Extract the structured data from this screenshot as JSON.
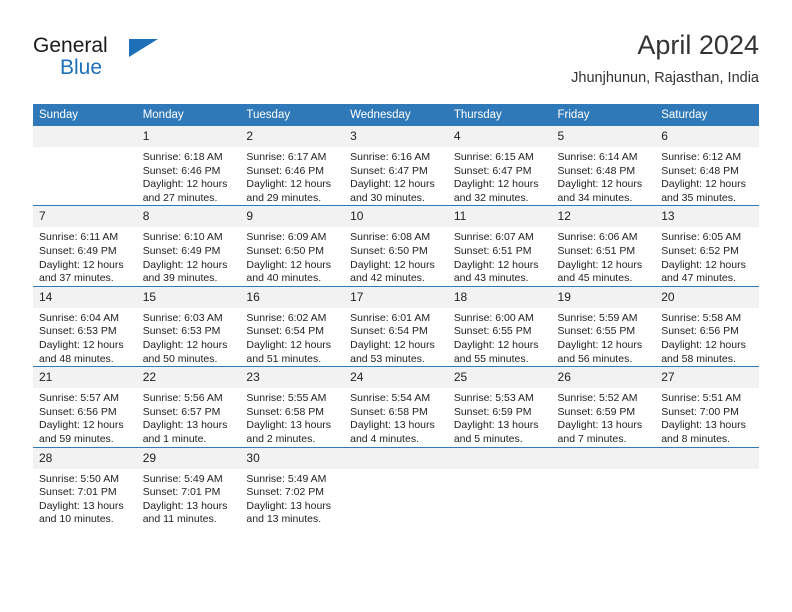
{
  "brand": {
    "name_part1": "General",
    "name_part2": "Blue"
  },
  "header": {
    "title": "April 2024",
    "subtitle": "Jhunjhunun, Rajasthan, India"
  },
  "weekday_headers": [
    "Sunday",
    "Monday",
    "Tuesday",
    "Wednesday",
    "Thursday",
    "Friday",
    "Saturday"
  ],
  "colors": {
    "header_blue": "#3079b8",
    "brand_blue": "#1d70b8",
    "daynum_bg": "#f2f2f2",
    "text": "#222222"
  },
  "labels": {
    "sunrise_prefix": "Sunrise:",
    "sunset_prefix": "Sunset:",
    "daylight_prefix": "Daylight:"
  },
  "weeks": [
    [
      {
        "day": "",
        "sunrise": "",
        "sunset": "",
        "daylight_line1": "",
        "daylight_line2": ""
      },
      {
        "day": "1",
        "sunrise": "Sunrise: 6:18 AM",
        "sunset": "Sunset: 6:46 PM",
        "daylight_line1": "Daylight: 12 hours",
        "daylight_line2": "and 27 minutes."
      },
      {
        "day": "2",
        "sunrise": "Sunrise: 6:17 AM",
        "sunset": "Sunset: 6:46 PM",
        "daylight_line1": "Daylight: 12 hours",
        "daylight_line2": "and 29 minutes."
      },
      {
        "day": "3",
        "sunrise": "Sunrise: 6:16 AM",
        "sunset": "Sunset: 6:47 PM",
        "daylight_line1": "Daylight: 12 hours",
        "daylight_line2": "and 30 minutes."
      },
      {
        "day": "4",
        "sunrise": "Sunrise: 6:15 AM",
        "sunset": "Sunset: 6:47 PM",
        "daylight_line1": "Daylight: 12 hours",
        "daylight_line2": "and 32 minutes."
      },
      {
        "day": "5",
        "sunrise": "Sunrise: 6:14 AM",
        "sunset": "Sunset: 6:48 PM",
        "daylight_line1": "Daylight: 12 hours",
        "daylight_line2": "and 34 minutes."
      },
      {
        "day": "6",
        "sunrise": "Sunrise: 6:12 AM",
        "sunset": "Sunset: 6:48 PM",
        "daylight_line1": "Daylight: 12 hours",
        "daylight_line2": "and 35 minutes."
      }
    ],
    [
      {
        "day": "7",
        "sunrise": "Sunrise: 6:11 AM",
        "sunset": "Sunset: 6:49 PM",
        "daylight_line1": "Daylight: 12 hours",
        "daylight_line2": "and 37 minutes."
      },
      {
        "day": "8",
        "sunrise": "Sunrise: 6:10 AM",
        "sunset": "Sunset: 6:49 PM",
        "daylight_line1": "Daylight: 12 hours",
        "daylight_line2": "and 39 minutes."
      },
      {
        "day": "9",
        "sunrise": "Sunrise: 6:09 AM",
        "sunset": "Sunset: 6:50 PM",
        "daylight_line1": "Daylight: 12 hours",
        "daylight_line2": "and 40 minutes."
      },
      {
        "day": "10",
        "sunrise": "Sunrise: 6:08 AM",
        "sunset": "Sunset: 6:50 PM",
        "daylight_line1": "Daylight: 12 hours",
        "daylight_line2": "and 42 minutes."
      },
      {
        "day": "11",
        "sunrise": "Sunrise: 6:07 AM",
        "sunset": "Sunset: 6:51 PM",
        "daylight_line1": "Daylight: 12 hours",
        "daylight_line2": "and 43 minutes."
      },
      {
        "day": "12",
        "sunrise": "Sunrise: 6:06 AM",
        "sunset": "Sunset: 6:51 PM",
        "daylight_line1": "Daylight: 12 hours",
        "daylight_line2": "and 45 minutes."
      },
      {
        "day": "13",
        "sunrise": "Sunrise: 6:05 AM",
        "sunset": "Sunset: 6:52 PM",
        "daylight_line1": "Daylight: 12 hours",
        "daylight_line2": "and 47 minutes."
      }
    ],
    [
      {
        "day": "14",
        "sunrise": "Sunrise: 6:04 AM",
        "sunset": "Sunset: 6:53 PM",
        "daylight_line1": "Daylight: 12 hours",
        "daylight_line2": "and 48 minutes."
      },
      {
        "day": "15",
        "sunrise": "Sunrise: 6:03 AM",
        "sunset": "Sunset: 6:53 PM",
        "daylight_line1": "Daylight: 12 hours",
        "daylight_line2": "and 50 minutes."
      },
      {
        "day": "16",
        "sunrise": "Sunrise: 6:02 AM",
        "sunset": "Sunset: 6:54 PM",
        "daylight_line1": "Daylight: 12 hours",
        "daylight_line2": "and 51 minutes."
      },
      {
        "day": "17",
        "sunrise": "Sunrise: 6:01 AM",
        "sunset": "Sunset: 6:54 PM",
        "daylight_line1": "Daylight: 12 hours",
        "daylight_line2": "and 53 minutes."
      },
      {
        "day": "18",
        "sunrise": "Sunrise: 6:00 AM",
        "sunset": "Sunset: 6:55 PM",
        "daylight_line1": "Daylight: 12 hours",
        "daylight_line2": "and 55 minutes."
      },
      {
        "day": "19",
        "sunrise": "Sunrise: 5:59 AM",
        "sunset": "Sunset: 6:55 PM",
        "daylight_line1": "Daylight: 12 hours",
        "daylight_line2": "and 56 minutes."
      },
      {
        "day": "20",
        "sunrise": "Sunrise: 5:58 AM",
        "sunset": "Sunset: 6:56 PM",
        "daylight_line1": "Daylight: 12 hours",
        "daylight_line2": "and 58 minutes."
      }
    ],
    [
      {
        "day": "21",
        "sunrise": "Sunrise: 5:57 AM",
        "sunset": "Sunset: 6:56 PM",
        "daylight_line1": "Daylight: 12 hours",
        "daylight_line2": "and 59 minutes."
      },
      {
        "day": "22",
        "sunrise": "Sunrise: 5:56 AM",
        "sunset": "Sunset: 6:57 PM",
        "daylight_line1": "Daylight: 13 hours",
        "daylight_line2": "and 1 minute."
      },
      {
        "day": "23",
        "sunrise": "Sunrise: 5:55 AM",
        "sunset": "Sunset: 6:58 PM",
        "daylight_line1": "Daylight: 13 hours",
        "daylight_line2": "and 2 minutes."
      },
      {
        "day": "24",
        "sunrise": "Sunrise: 5:54 AM",
        "sunset": "Sunset: 6:58 PM",
        "daylight_line1": "Daylight: 13 hours",
        "daylight_line2": "and 4 minutes."
      },
      {
        "day": "25",
        "sunrise": "Sunrise: 5:53 AM",
        "sunset": "Sunset: 6:59 PM",
        "daylight_line1": "Daylight: 13 hours",
        "daylight_line2": "and 5 minutes."
      },
      {
        "day": "26",
        "sunrise": "Sunrise: 5:52 AM",
        "sunset": "Sunset: 6:59 PM",
        "daylight_line1": "Daylight: 13 hours",
        "daylight_line2": "and 7 minutes."
      },
      {
        "day": "27",
        "sunrise": "Sunrise: 5:51 AM",
        "sunset": "Sunset: 7:00 PM",
        "daylight_line1": "Daylight: 13 hours",
        "daylight_line2": "and 8 minutes."
      }
    ],
    [
      {
        "day": "28",
        "sunrise": "Sunrise: 5:50 AM",
        "sunset": "Sunset: 7:01 PM",
        "daylight_line1": "Daylight: 13 hours",
        "daylight_line2": "and 10 minutes."
      },
      {
        "day": "29",
        "sunrise": "Sunrise: 5:49 AM",
        "sunset": "Sunset: 7:01 PM",
        "daylight_line1": "Daylight: 13 hours",
        "daylight_line2": "and 11 minutes."
      },
      {
        "day": "30",
        "sunrise": "Sunrise: 5:49 AM",
        "sunset": "Sunset: 7:02 PM",
        "daylight_line1": "Daylight: 13 hours",
        "daylight_line2": "and 13 minutes."
      },
      {
        "day": "",
        "sunrise": "",
        "sunset": "",
        "daylight_line1": "",
        "daylight_line2": ""
      },
      {
        "day": "",
        "sunrise": "",
        "sunset": "",
        "daylight_line1": "",
        "daylight_line2": ""
      },
      {
        "day": "",
        "sunrise": "",
        "sunset": "",
        "daylight_line1": "",
        "daylight_line2": ""
      },
      {
        "day": "",
        "sunrise": "",
        "sunset": "",
        "daylight_line1": "",
        "daylight_line2": ""
      }
    ]
  ]
}
